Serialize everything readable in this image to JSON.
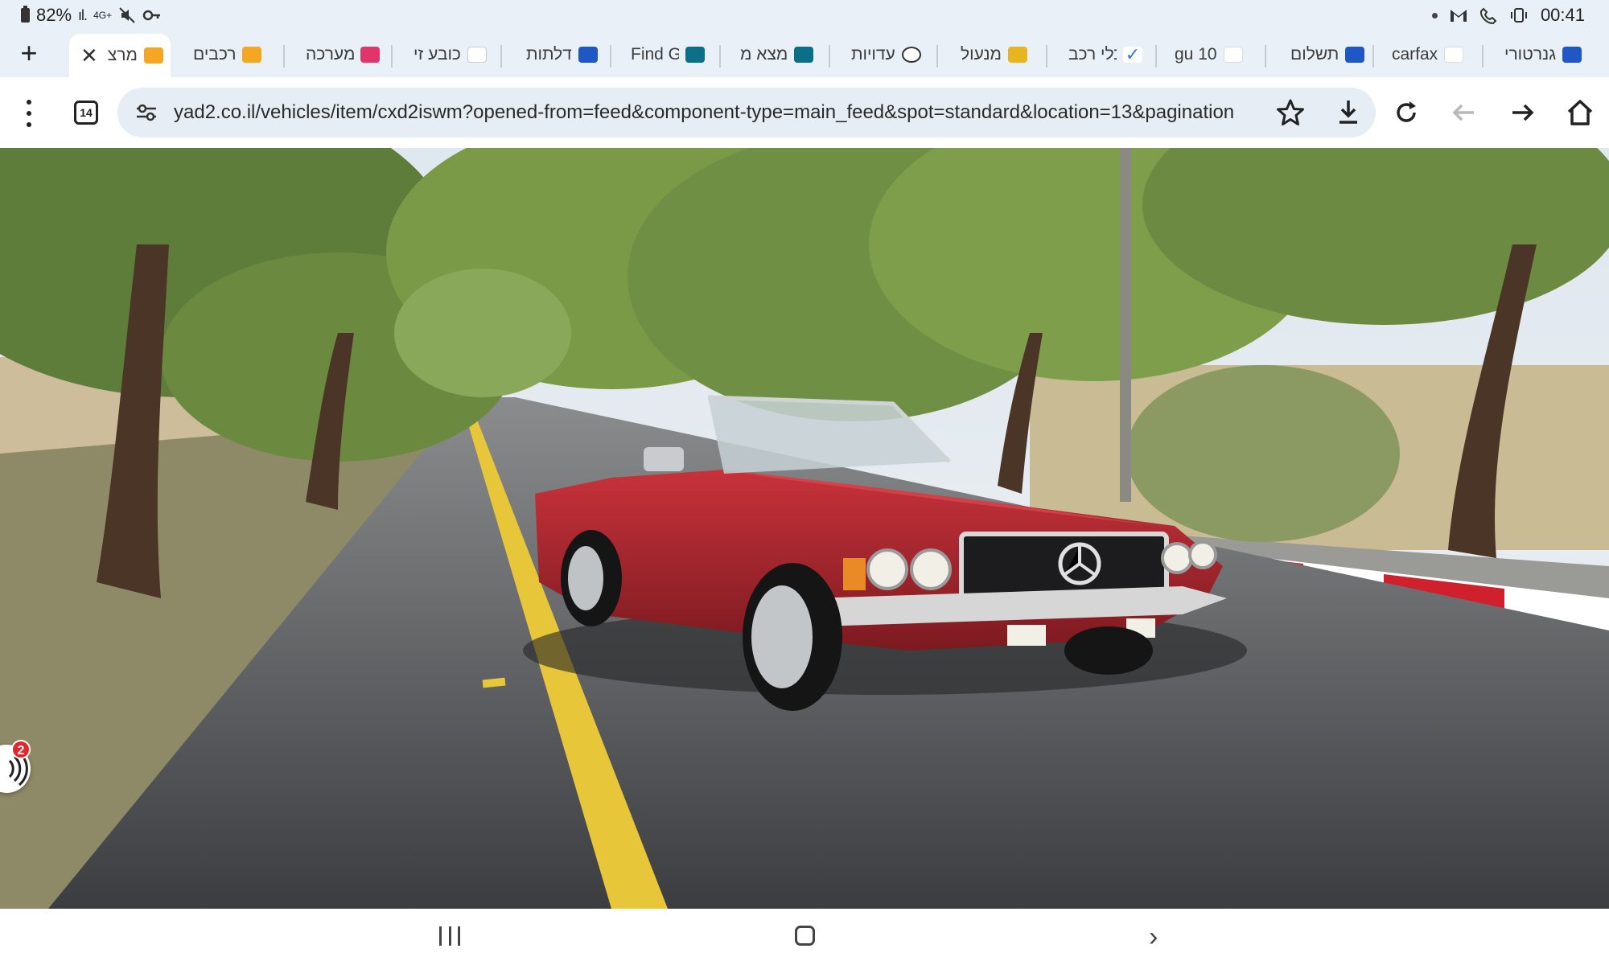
{
  "status_bar": {
    "battery": "82%",
    "network": "4G+",
    "time": "00:41"
  },
  "tabs": [
    {
      "label": "מרצ",
      "active": true,
      "icon_color": "#f5a623"
    },
    {
      "label": "רכבים",
      "active": false,
      "icon_color": "#f5a623"
    },
    {
      "label": "מערכה",
      "active": false,
      "icon_color": "#e0356b"
    },
    {
      "label": "כובע זי",
      "active": false,
      "icon_color": "#9e9e9e"
    },
    {
      "label": "דלתות",
      "active": false,
      "icon_color": "#1f57c4"
    },
    {
      "label": "Find G",
      "active": false,
      "icon_color": "#0b6f8a"
    },
    {
      "label": "מצא מ",
      "active": false,
      "icon_color": "#0b6f8a"
    },
    {
      "label": "עדויות",
      "active": false,
      "icon_color": "#333333"
    },
    {
      "label": "מנעול",
      "active": false,
      "icon_color": "#e8b520"
    },
    {
      "label": "כלי רכב",
      "active": false,
      "icon_color": "#2a7bd8"
    },
    {
      "label": "gu 10",
      "active": false,
      "icon_color": "#ffffff"
    },
    {
      "label": "תשלום",
      "active": false,
      "icon_color": "#1f57c4"
    },
    {
      "label": "carfax",
      "active": false,
      "icon_color": "#ffffff"
    },
    {
      "label": "גנרטורי",
      "active": false,
      "icon_color": "#1f57c4"
    }
  ],
  "toolbar": {
    "tab_count": "14",
    "url": "yad2.co.il/vehicles/item/cxd2iswm?opened-from=feed&component-type=main_feed&spot=standard&location=13&pagination"
  },
  "content": {
    "badge_count": "2"
  }
}
